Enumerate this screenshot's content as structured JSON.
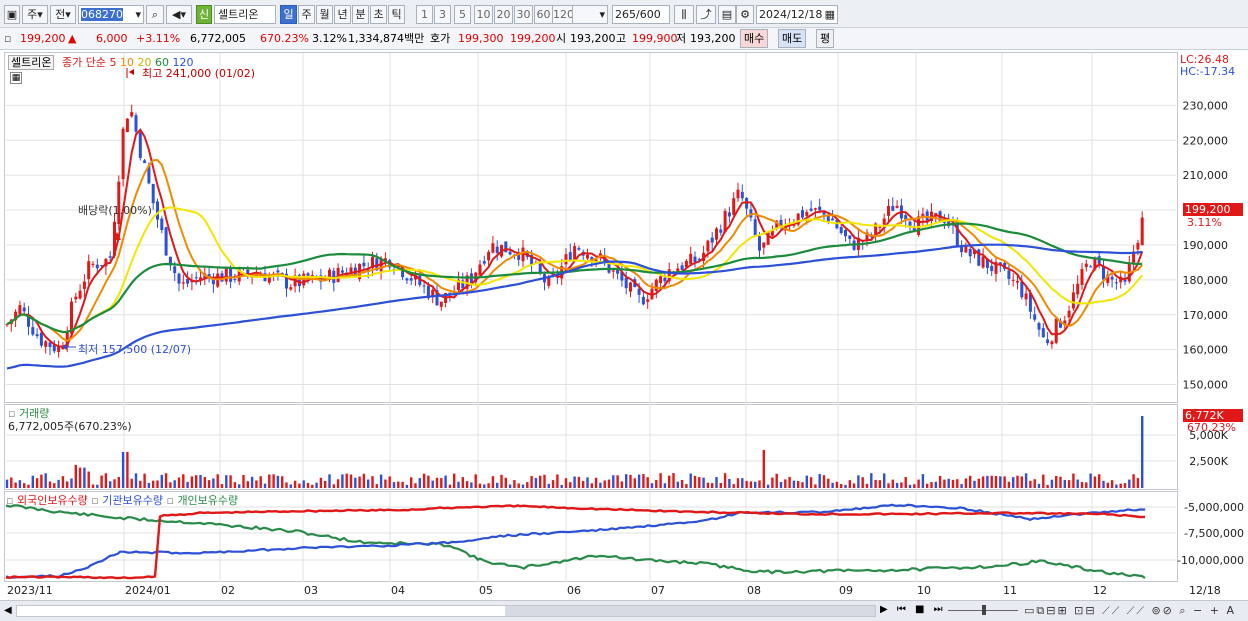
{
  "toolbar": {
    "period_label": "주",
    "prev_label": "전",
    "stock_code": "068270",
    "badge": "신",
    "stock_name": "셀트리온",
    "interval_tabs": [
      "일",
      "주",
      "월",
      "년",
      "분",
      "초",
      "틱"
    ],
    "active_interval": "일",
    "minute_options": [
      "1",
      "3",
      "5",
      "10",
      "20",
      "30",
      "60",
      "120"
    ],
    "count_display": "265",
    "count_max": "/600",
    "date": "2024/12/18"
  },
  "quote": {
    "price": "199,200",
    "arrow": "▲",
    "change": "6,000",
    "change_pct": "+3.11%",
    "volume": "6,772,005",
    "volume_ratio": "670.23%",
    "turnover": "3.12%",
    "amount": "1,334,874백만",
    "bid_label": "호가",
    "bid1": "199,300",
    "bid2": "199,200",
    "open_label": "시",
    "open": "193,200",
    "high_label": "고",
    "high": "199,900",
    "low_label": "저",
    "low": "193,200",
    "buy_label": "매수",
    "sell_label": "매도",
    "flat_label": "평"
  },
  "price_pane": {
    "stock_label": "셀트리온",
    "ma_label": "종가 단순",
    "ma_periods": [
      "5",
      "10",
      "20",
      "60",
      "120"
    ],
    "ma_colors": [
      "#e01818",
      "#f08a00",
      "#f2e600",
      "#1c8c3c",
      "#2c50d8"
    ],
    "lc": "LC:26.48",
    "hc": "HC:-17.34",
    "high_note": "최고 241,000 (01/02)",
    "low_note": "최저 157,500 (12/07)",
    "dividend_note": "배당락(1.00%)",
    "price_tag": "199,200",
    "price_tag_pct": "3.11%",
    "y_ticks": [
      "230,000",
      "220,000",
      "210,000",
      "200,000",
      "190,000",
      "180,000",
      "170,000",
      "160,000",
      "150,000"
    ],
    "y_tick_values": [
      230000,
      220000,
      210000,
      200000,
      190000,
      180000,
      170000,
      160000,
      150000
    ]
  },
  "volume_pane": {
    "title": "거래량",
    "value_label": "6,772,005주(670.23%)",
    "tag_value": "6,772K",
    "tag_pct": "670.23%",
    "y_ticks": [
      "5,000K",
      "2,500K"
    ]
  },
  "holdings_pane": {
    "series_labels": [
      "외국인보유수량",
      "기관보유수량",
      "개인보유수량"
    ],
    "series_colors": [
      "#e01818",
      "#2c50d8",
      "#2a8a4a"
    ],
    "y_ticks": [
      "-5,000,000",
      "-7,500,000",
      "-10,000,000"
    ]
  },
  "x_axis": [
    "2023/11",
    "2024/01",
    "02",
    "03",
    "04",
    "05",
    "06",
    "07",
    "08",
    "09",
    "10",
    "11",
    "12",
    "12/18"
  ],
  "chart_data": {
    "type": "line",
    "title": "셀트리온",
    "x": [
      "2023/11",
      "2023/12",
      "2024/01",
      "02",
      "03",
      "04",
      "05",
      "06",
      "07",
      "08",
      "09",
      "10",
      "11",
      "12",
      "12/18"
    ],
    "series": [
      {
        "name": "종가",
        "values": [
          168000,
          160000,
          230000,
          183000,
          180000,
          178000,
          190000,
          178000,
          176000,
          205000,
          200000,
          188000,
          165000,
          180000,
          199200
        ]
      },
      {
        "name": "120",
        "values": [
          152000,
          151000,
          153000,
          160000,
          167000,
          174000,
          181000,
          184000,
          183000,
          187000,
          189000,
          190000,
          188000,
          188000,
          189000
        ]
      }
    ],
    "ylim": [
      145000,
      245000
    ]
  }
}
